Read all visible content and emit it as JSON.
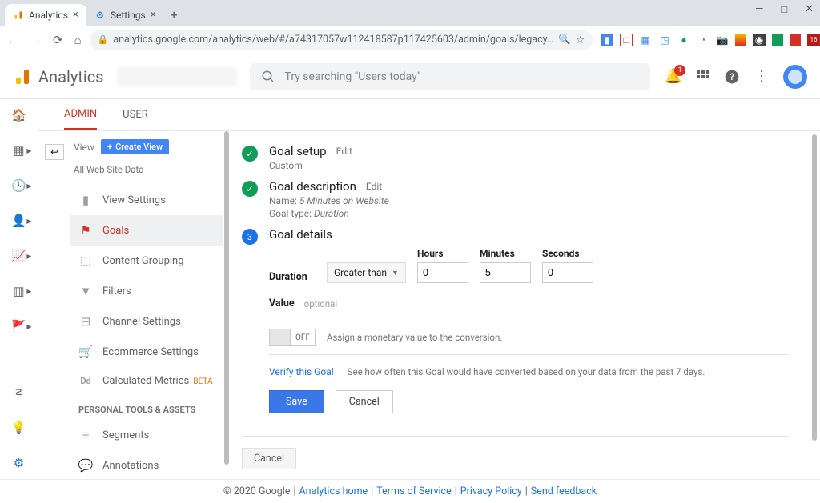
{
  "window": {
    "minimize": "—",
    "maximize": "□",
    "close": "✕"
  },
  "tabs": [
    {
      "title": "Analytics",
      "active": true
    },
    {
      "title": "Settings",
      "active": false
    }
  ],
  "url": "analytics.google.com/analytics/web/#/a74317057w112418587p117425603/admin/goals/legacy…",
  "app": {
    "name": "Analytics",
    "search_placeholder": "Try searching \"Users today\"",
    "notification_count": "1"
  },
  "subtabs": {
    "admin": "ADMIN",
    "user": "USER"
  },
  "view_panel": {
    "label": "View",
    "create_btn": "Create View",
    "all_data": "All Web Site Data",
    "items": {
      "view_settings": "View Settings",
      "goals": "Goals",
      "content_grouping": "Content Grouping",
      "filters": "Filters",
      "channel_settings": "Channel Settings",
      "ecommerce_settings": "Ecommerce Settings",
      "calculated_metrics": "Calculated Metrics",
      "calc_beta": "BETA"
    },
    "section_title": "PERSONAL TOOLS & ASSETS",
    "personal": {
      "segments": "Segments",
      "annotations": "Annotations"
    }
  },
  "goal": {
    "step1_title": "Goal setup",
    "step1_edit": "Edit",
    "step1_sub": "Custom",
    "step2_title": "Goal description",
    "step2_edit": "Edit",
    "step2_name_label": "Name:",
    "step2_name_value": "5 Minutes on Website",
    "step2_type_label": "Goal type:",
    "step2_type_value": "Duration",
    "step3_num": "3",
    "step3_title": "Goal details",
    "duration_label": "Duration",
    "duration_operator": "Greater than",
    "hours_label": "Hours",
    "hours_value": "0",
    "minutes_label": "Minutes",
    "minutes_value": "5",
    "seconds_label": "Seconds",
    "seconds_value": "0",
    "value_label": "Value",
    "value_optional": "optional",
    "value_toggle": "OFF",
    "value_desc": "Assign a monetary value to the conversion.",
    "verify_link": "Verify this Goal",
    "verify_desc": "See how often this Goal would have converted based on your data from the past 7 days.",
    "save": "Save",
    "cancel": "Cancel",
    "cancel2": "Cancel"
  },
  "footer": {
    "copyright": "© 2020 Google",
    "links": {
      "home": "Analytics home",
      "tos": "Terms of Service",
      "privacy": "Privacy Policy",
      "feedback": "Send feedback"
    }
  }
}
